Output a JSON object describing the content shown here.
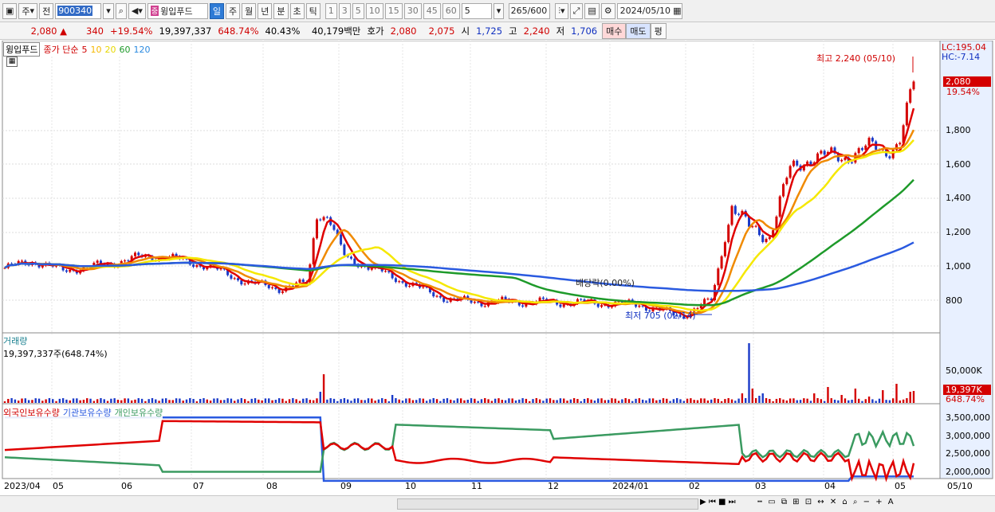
{
  "toolbar": {
    "market": "주",
    "prev": "전",
    "code": "900340",
    "stock_name": "윙입푸드",
    "periods": [
      "일",
      "주",
      "월",
      "년",
      "분",
      "초",
      "틱"
    ],
    "selected_period": "일",
    "intervals": [
      "1",
      "3",
      "5",
      "10",
      "15",
      "30",
      "45",
      "60"
    ],
    "interval_value": "5",
    "count": "265",
    "count_max": "/600",
    "date": "2024/05/10"
  },
  "quote": {
    "price": "2,080 ▲",
    "change": "340",
    "change_pct": "+19.54%",
    "volume": "19,397,337",
    "volume_pct": "648.74%",
    "turnover": "40.43%",
    "amount": "40,179백만",
    "hoga_label": "호가",
    "ask": "2,080",
    "bid": "2,075",
    "open_label": "시",
    "open": "1,725",
    "high_label": "고",
    "high": "2,240",
    "low_label": "저",
    "low": "1,706",
    "buy": "매수",
    "sell": "매도",
    "eval": "평"
  },
  "legend_main": {
    "name": "윙입푸드",
    "close": "종가 단순",
    "ma": [
      "5",
      "10",
      "20",
      "60",
      "120"
    ]
  },
  "legend_volume": {
    "title": "거래량",
    "value": "19,397,337주(648.74%)"
  },
  "legend_holding": {
    "items": [
      "외국인보유수량",
      "기관보유수량",
      "개인보유수량"
    ]
  },
  "right_axis": {
    "lc": "LC:195.04",
    "hc": "HC:-7.14",
    "price_box": "2,080",
    "pct_box": "19.54%",
    "price_ticks": [
      "1,800",
      "1,600",
      "1,400",
      "1,200",
      "1,000",
      "800"
    ],
    "vol_tick": "50,000K",
    "vol_box": "19,397K",
    "vol_pct": "648.74%",
    "hold_ticks": [
      "3,500,000",
      "3,000,000",
      "2,500,000",
      "2,000,000"
    ],
    "date_end": "05/10"
  },
  "annotations": {
    "high": "최고 2,240 (05/10)",
    "low": "최저 705 (02/14)",
    "dividend": "배당락(0.00%)"
  },
  "x_axis": [
    "2023/04",
    "05",
    "06",
    "07",
    "08",
    "09",
    "10",
    "11",
    "12",
    "2024/01",
    "02",
    "03",
    "04",
    "05"
  ],
  "colors": {
    "up": "#d40000",
    "down": "#1a3ac8",
    "ma5": "#e00000",
    "ma10": "#f08a00",
    "ma20": "#f5e800",
    "ma60": "#1e9a2a",
    "ma120": "#2a5ae0",
    "foreign": "#e00000",
    "inst": "#2a5ae0",
    "indiv": "#3a9a60"
  }
}
